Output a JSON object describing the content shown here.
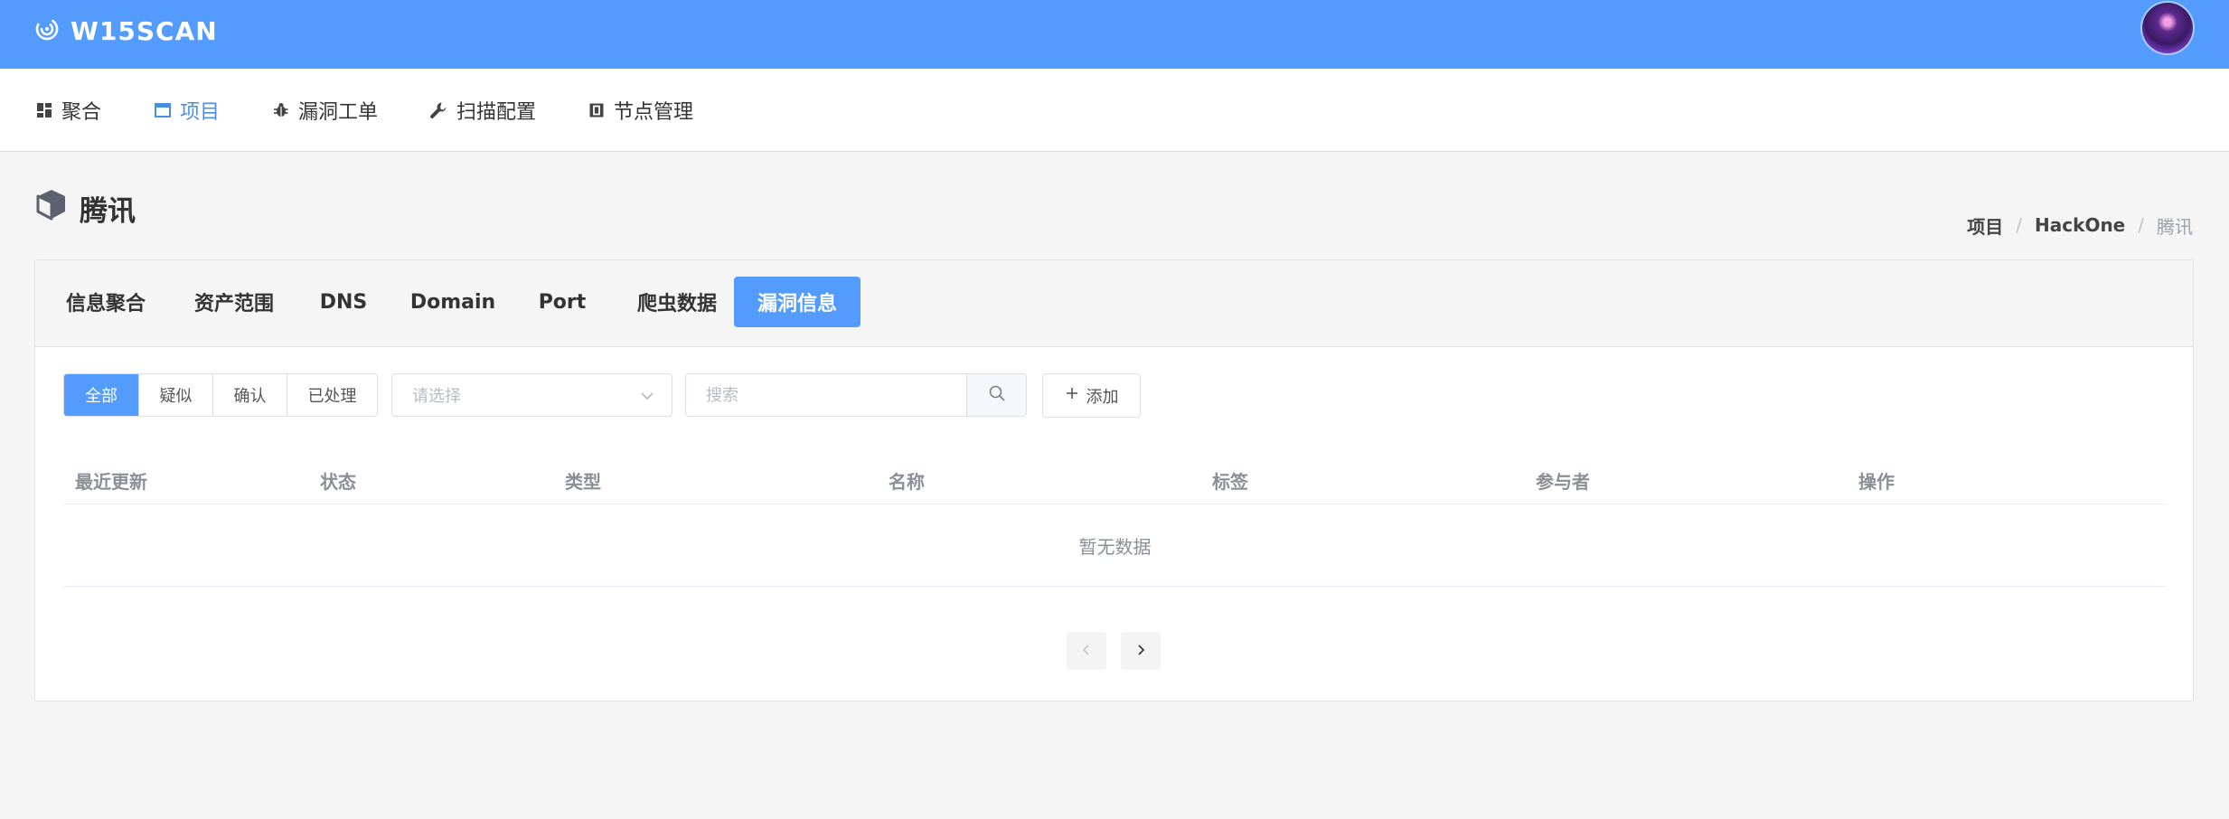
{
  "app": {
    "brand": "W15SCAN",
    "accent_color": "#539bfc"
  },
  "nav": {
    "items": [
      {
        "label": "聚合",
        "icon": "dashboard-icon",
        "active": false
      },
      {
        "label": "项目",
        "icon": "window-icon",
        "active": true
      },
      {
        "label": "漏洞工单",
        "icon": "bug-icon",
        "active": false
      },
      {
        "label": "扫描配置",
        "icon": "wrench-icon",
        "active": false
      },
      {
        "label": "节点管理",
        "icon": "node-icon",
        "active": false
      }
    ]
  },
  "page": {
    "title": "腾讯",
    "title_icon": "cube-icon",
    "breadcrumb": [
      "项目",
      "HackOne",
      "腾讯"
    ]
  },
  "tabs": [
    "信息聚合",
    "资产范围",
    "DNS",
    "Domain",
    "Port",
    "爬虫数据",
    "漏洞信息"
  ],
  "active_tab": "漏洞信息",
  "filters": {
    "status": [
      "全部",
      "疑似",
      "确认",
      "已处理"
    ],
    "active_status": "全部",
    "select_placeholder": "请选择",
    "search_placeholder": "搜索",
    "add_label": "添加"
  },
  "table": {
    "columns": [
      "最近更新",
      "状态",
      "类型",
      "名称",
      "标签",
      "参与者",
      "操作"
    ],
    "rows": [],
    "empty_text": "暂无数据"
  }
}
